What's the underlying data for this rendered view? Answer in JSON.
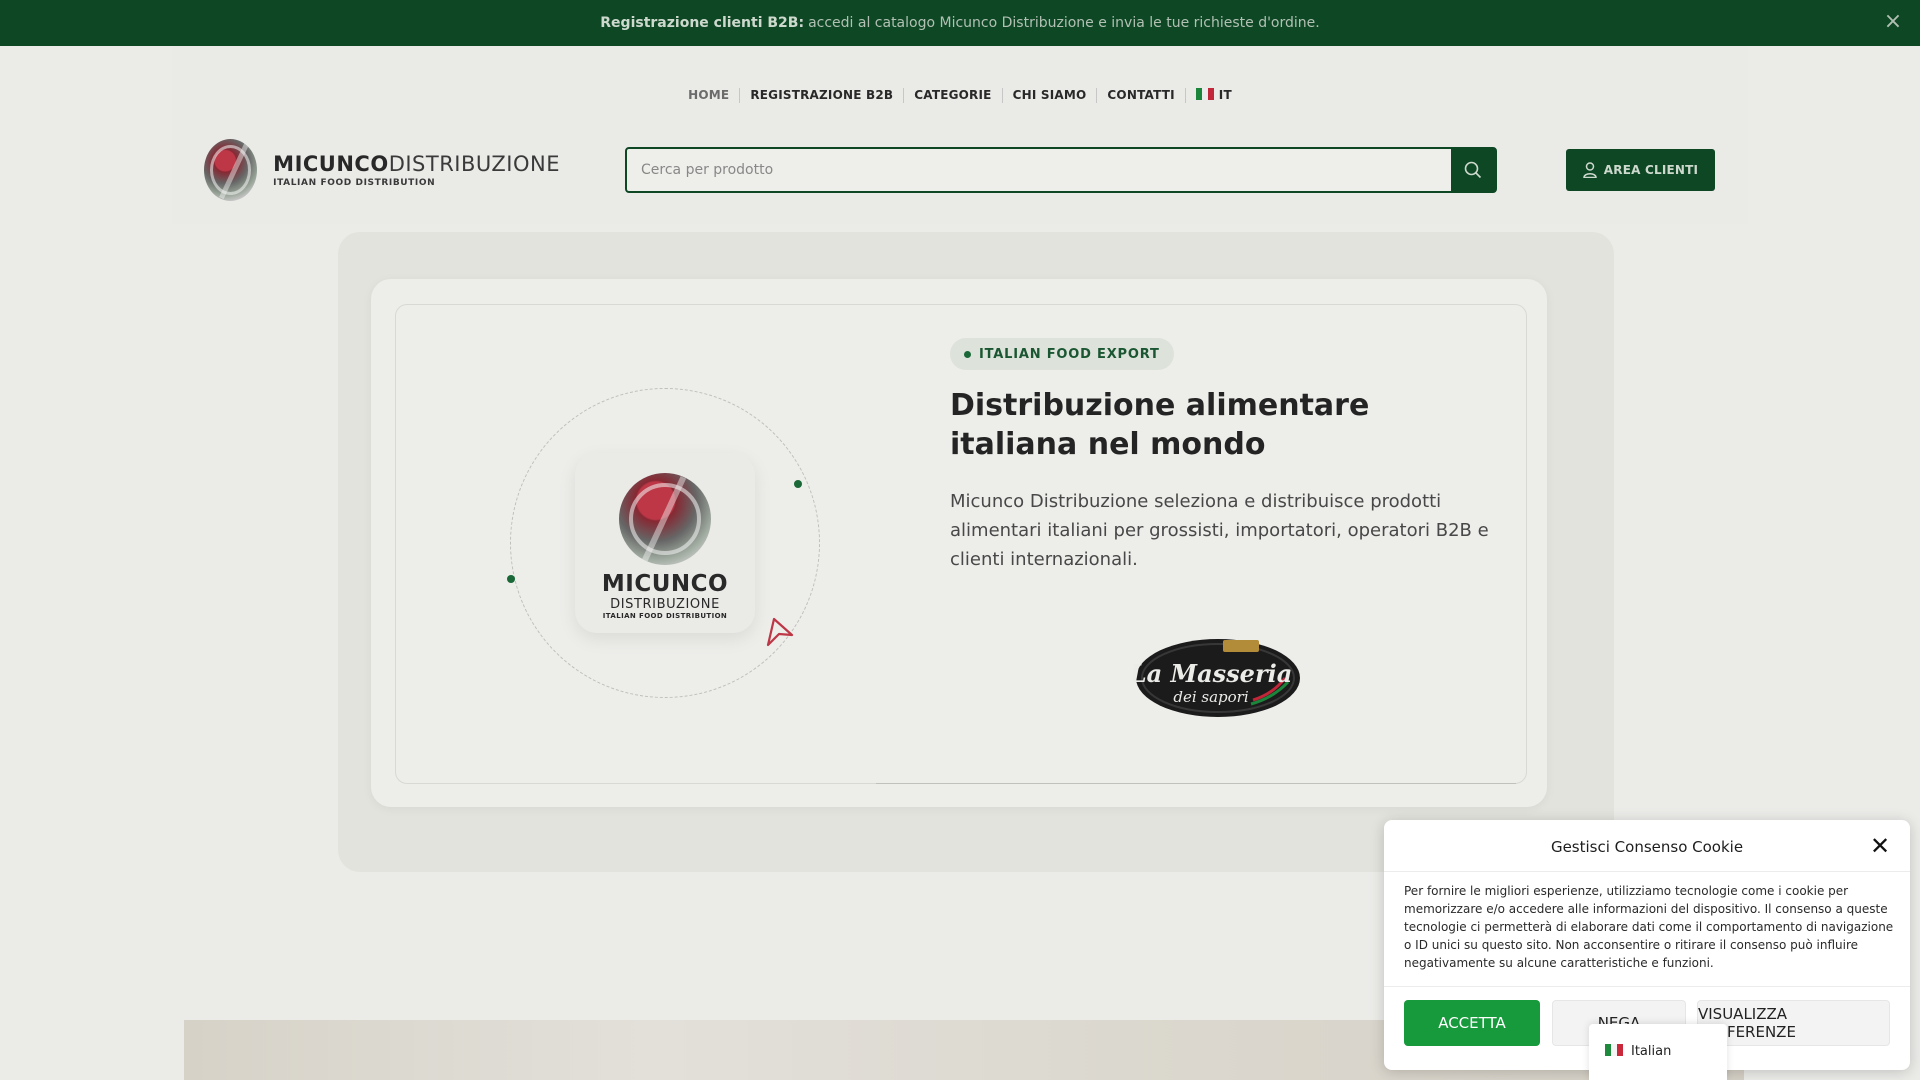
{
  "topbar": {
    "bold": "Registrazione clienti B2B:",
    "text": "accedi al catalogo Micunco Distribuzione e invia le tue richieste d'ordine.",
    "close_icon": "close-icon"
  },
  "nav": {
    "home": "HOME",
    "registrazione": "REGISTRAZIONE B2B",
    "categorie": "CATEGORIE",
    "chi_siamo": "CHI SIAMO",
    "contatti": "CONTATTI",
    "lang": "IT"
  },
  "logo": {
    "bold": "MICUNCO",
    "light": "DISTRIBUZIONE",
    "sub": "ITALIAN FOOD DISTRIBUTION"
  },
  "search": {
    "placeholder": "Cerca per prodotto",
    "icon": "search-icon"
  },
  "account": {
    "label": "AREA CLIENTI",
    "icon": "user-icon"
  },
  "hero": {
    "badge": "ITALIAN FOOD EXPORT",
    "headline": "Distribuzione alimentare italiana nel mondo",
    "lead": "Micunco Distribuzione seleziona e distribuisce prodotti alimentari italiani per grossisti, importatori, operatori B2B e clienti internazionali.",
    "tile_name": "MICUNCO",
    "tile_sub": "DISTRIBUZIONE",
    "tile_tagline": "ITALIAN FOOD DISTRIBUTION",
    "partner_logo_line1": "La Masseria",
    "partner_logo_line2": "dei sapori"
  },
  "cookie": {
    "title": "Gestisci Consenso Cookie",
    "body": "Per fornire le migliori esperienze, utilizziamo tecnologie come i cookie per memorizzare e/o accedere alle informazioni del dispositivo. Il consenso a queste tecnologie ci permetterà di elaborare dati come il comportamento di navigazione o ID unici su questo sito. Non acconsentire o ritirare il consenso può influire negativamente su alcune caratteristiche e funzioni.",
    "accept": "ACCETTA",
    "deny": "NEGA",
    "prefs": "VISUALIZZA PREFERENZE",
    "language": "Italian"
  },
  "colors": {
    "brand_green": "#0e4a26",
    "accept_green": "#169a3b",
    "flag_green": "#1d8a3e",
    "flag_red": "#c9293b"
  }
}
